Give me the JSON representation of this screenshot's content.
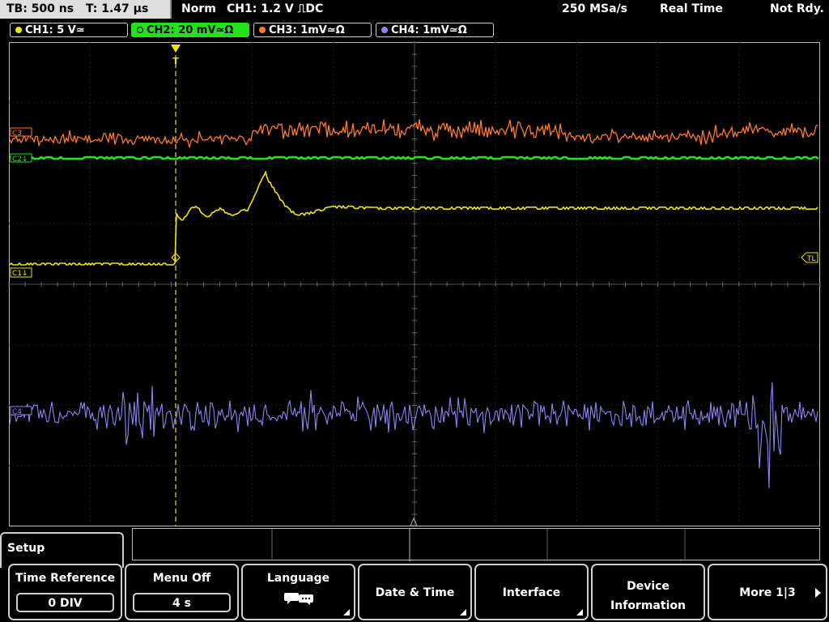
{
  "status": {
    "timebase": "TB: 500 ns",
    "trigger_time": "T: 1.47 μs",
    "mode": "Norm",
    "trigger": "CH1: 1.2 V ⎍DC",
    "sample_rate": "250 MSa/s",
    "acq_mode": "Real Time",
    "state": "Not Rdy."
  },
  "channels": [
    {
      "label": "CH1: 5 V≃",
      "color": "#f1e600"
    },
    {
      "label": "CH2: 20 mV≃Ω",
      "color": "#23e11a"
    },
    {
      "label": "CH3: 1mV≃Ω",
      "color": "#ff7a2a"
    },
    {
      "label": "CH4: 1mV≃Ω",
      "color": "#8a86f3"
    }
  ],
  "markers": {
    "c1": "C1↓",
    "c2": "C2↓",
    "c3": "C3",
    "c4": "C4",
    "trigger_level": "TL",
    "trigger_point": "T"
  },
  "menu": {
    "title": "Setup",
    "softkeys": [
      {
        "label": "Time Reference",
        "value": "0 DIV"
      },
      {
        "label": "Menu Off",
        "value": "4 s"
      },
      {
        "label": "Language",
        "icon": "speech-bubbles-icon"
      },
      {
        "label": "Date & Time"
      },
      {
        "label": "Interface"
      },
      {
        "label_line1": "Device",
        "label_line2": "Information"
      },
      {
        "label": "More 1|3"
      }
    ]
  }
}
